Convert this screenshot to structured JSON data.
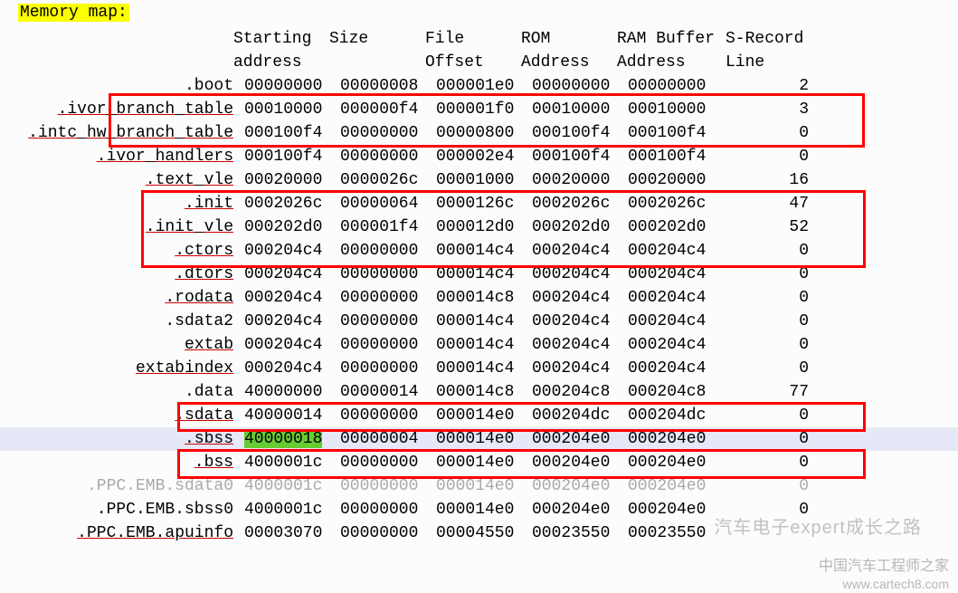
{
  "title": "Memory map:",
  "headers": {
    "line1": {
      "c1": "Starting",
      "c2": "Size",
      "c3": "File",
      "c4": "ROM",
      "c5": "RAM Buffer",
      "c6": "S-Record"
    },
    "line2": {
      "c1": "address",
      "c2": "",
      "c3": "Offset",
      "c4": "Address",
      "c5": "Address",
      "c6": "Line"
    }
  },
  "rows": [
    {
      "name": ".boot",
      "c1": "00000000",
      "c2": "00000008",
      "c3": "000001e0",
      "c4": "00000000",
      "c5": "00000000",
      "c6": "2",
      "underline": false
    },
    {
      "name": ".ivor_branch_table",
      "c1": "00010000",
      "c2": "000000f4",
      "c3": "000001f0",
      "c4": "00010000",
      "c5": "00010000",
      "c6": "3",
      "underline": true
    },
    {
      "name": ".intc_hw_branch_table",
      "c1": "000100f4",
      "c2": "00000000",
      "c3": "00000800",
      "c4": "000100f4",
      "c5": "000100f4",
      "c6": "0",
      "underline": true
    },
    {
      "name": ".ivor_handlers",
      "c1": "000100f4",
      "c2": "00000000",
      "c3": "000002e4",
      "c4": "000100f4",
      "c5": "000100f4",
      "c6": "0",
      "underline": true
    },
    {
      "name": ".text_vle",
      "c1": "00020000",
      "c2": "0000026c",
      "c3": "00001000",
      "c4": "00020000",
      "c5": "00020000",
      "c6": "16",
      "underline": true
    },
    {
      "name": ".init",
      "c1": "0002026c",
      "c2": "00000064",
      "c3": "0000126c",
      "c4": "0002026c",
      "c5": "0002026c",
      "c6": "47",
      "underline": true
    },
    {
      "name": ".init_vle",
      "c1": "000202d0",
      "c2": "000001f4",
      "c3": "000012d0",
      "c4": "000202d0",
      "c5": "000202d0",
      "c6": "52",
      "underline": true
    },
    {
      "name": ".ctors",
      "c1": "000204c4",
      "c2": "00000000",
      "c3": "000014c4",
      "c4": "000204c4",
      "c5": "000204c4",
      "c6": "0",
      "underline": true
    },
    {
      "name": ".dtors",
      "c1": "000204c4",
      "c2": "00000000",
      "c3": "000014c4",
      "c4": "000204c4",
      "c5": "000204c4",
      "c6": "0",
      "underline": true
    },
    {
      "name": ".rodata",
      "c1": "000204c4",
      "c2": "00000000",
      "c3": "000014c8",
      "c4": "000204c4",
      "c5": "000204c4",
      "c6": "0",
      "underline": true
    },
    {
      "name": ".sdata2",
      "c1": "000204c4",
      "c2": "00000000",
      "c3": "000014c4",
      "c4": "000204c4",
      "c5": "000204c4",
      "c6": "0",
      "underline": false
    },
    {
      "name": "extab",
      "c1": "000204c4",
      "c2": "00000000",
      "c3": "000014c4",
      "c4": "000204c4",
      "c5": "000204c4",
      "c6": "0",
      "underline": true
    },
    {
      "name": "extabindex",
      "c1": "000204c4",
      "c2": "00000000",
      "c3": "000014c4",
      "c4": "000204c4",
      "c5": "000204c4",
      "c6": "0",
      "underline": true
    },
    {
      "name": ".data",
      "c1": "40000000",
      "c2": "00000014",
      "c3": "000014c8",
      "c4": "000204c8",
      "c5": "000204c8",
      "c6": "77",
      "underline": false
    },
    {
      "name": ".sdata",
      "c1": "40000014",
      "c2": "00000000",
      "c3": "000014e0",
      "c4": "000204dc",
      "c5": "000204dc",
      "c6": "0",
      "underline": true
    },
    {
      "name": ".sbss",
      "c1": "40000018",
      "c2": "00000004",
      "c3": "000014e0",
      "c4": "000204e0",
      "c5": "000204e0",
      "c6": "0",
      "underline": true,
      "greenC1": true,
      "selected": true
    },
    {
      "name": ".bss",
      "c1": "4000001c",
      "c2": "00000000",
      "c3": "000014e0",
      "c4": "000204e0",
      "c5": "000204e0",
      "c6": "0",
      "underline": true
    },
    {
      "name": ".PPC.EMB.sdata0",
      "c1": "4000001c",
      "c2": "00000000",
      "c3": "000014e0",
      "c4": "000204e0",
      "c5": "000204e0",
      "c6": "0",
      "underline": false,
      "dim": true
    },
    {
      "name": ".PPC.EMB.sbss0",
      "c1": "4000001c",
      "c2": "00000000",
      "c3": "000014e0",
      "c4": "000204e0",
      "c5": "000204e0",
      "c6": "0",
      "underline": false
    },
    {
      "name": ".PPC.EMB.apuinfo",
      "c1": "00003070",
      "c2": "00000000",
      "c3": "00004550",
      "c4": "00023550",
      "c5": "00023550",
      "c6": "",
      "underline": true
    }
  ],
  "watermarks": {
    "w1": "汽车电子expert成长之路",
    "w2": "中国汽车工程师之家",
    "w3": "www.cartech8.com"
  }
}
